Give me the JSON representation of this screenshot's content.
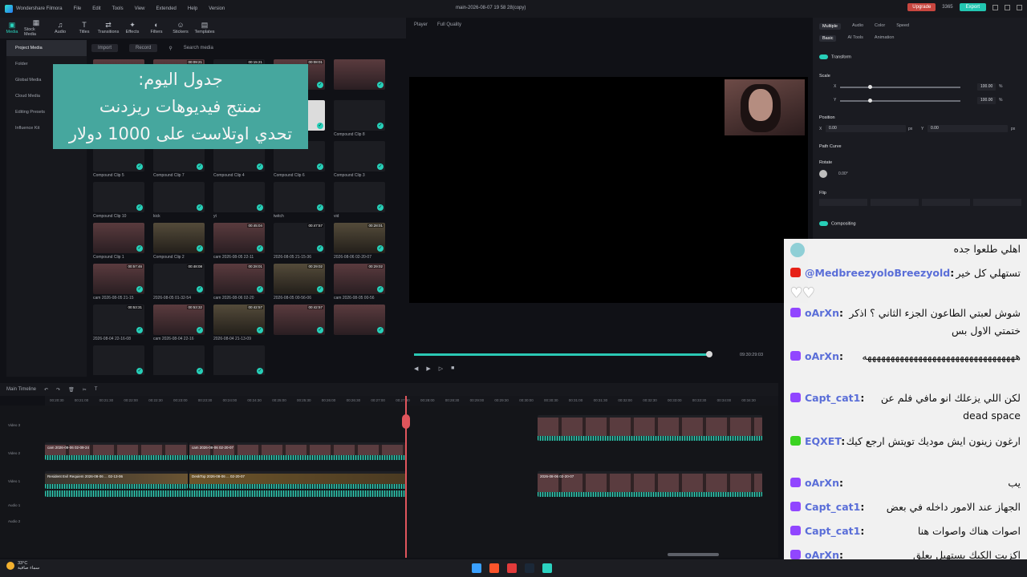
{
  "app": {
    "name": "Wondershare Filmora",
    "file": "main-2026-08-07 19 58 28(copy)",
    "credits": "3365",
    "upgrade": "Upgrade",
    "export": "Export"
  },
  "menu": [
    "File",
    "Edit",
    "Tools",
    "View",
    "Extended",
    "Help",
    "Version"
  ],
  "toolbar": [
    "Media",
    "Stock Media",
    "Audio",
    "Titles",
    "Transitions",
    "Effects",
    "Filters",
    "Stickers",
    "Templates"
  ],
  "sidebar": [
    "Project Media",
    "Folder",
    "Global Media",
    "Cloud Media",
    "Editing Presets",
    "Influence Kit"
  ],
  "mediabar": {
    "import": "Import",
    "record": "Record",
    "search_placeholder": "Search media"
  },
  "media": [
    {
      "name": "cam 2026-08-03 13-45",
      "dur": "",
      "t": "photo"
    },
    {
      "name": "",
      "dur": "00:09:21",
      "t": "photo"
    },
    {
      "name": "2026-08-05 00-59",
      "dur": "00:15:21",
      "t": "dark"
    },
    {
      "name": "",
      "dur": "00:08:01",
      "t": "photo"
    },
    {
      "name": "",
      "dur": "",
      "t": "photo"
    },
    {
      "name": "",
      "dur": "",
      "t": "photo"
    },
    {
      "name": "2026-08-05 23-51",
      "dur": "",
      "t": "dark"
    },
    {
      "name": "intro",
      "dur": "",
      "t": "dark"
    },
    {
      "name": "Compound Clip 9",
      "dur": "",
      "t": "white"
    },
    {
      "name": "Compound Clip 8",
      "dur": "",
      "t": "dark"
    },
    {
      "name": "Compound Clip 5",
      "dur": "",
      "t": "dark"
    },
    {
      "name": "Compound Clip 7",
      "dur": "",
      "t": "dark"
    },
    {
      "name": "Compound Clip 4",
      "dur": "",
      "t": "dark"
    },
    {
      "name": "Compound Clip 6",
      "dur": "",
      "t": "dark"
    },
    {
      "name": "Compound Clip 3",
      "dur": "",
      "t": "dark"
    },
    {
      "name": "Compound Clip 10",
      "dur": "",
      "t": "dark"
    },
    {
      "name": "kick",
      "dur": "",
      "t": "dark"
    },
    {
      "name": "yt",
      "dur": "",
      "t": "dark"
    },
    {
      "name": "twitch",
      "dur": "",
      "t": "dark"
    },
    {
      "name": "vid",
      "dur": "",
      "t": "dark"
    },
    {
      "name": "Compound Clip 1",
      "dur": "",
      "t": "photo"
    },
    {
      "name": "Compound Clip 2",
      "dur": "",
      "t": "scene"
    },
    {
      "name": "cam 2026-08-05 22-11",
      "dur": "00:45:04",
      "t": "photo"
    },
    {
      "name": "2026-08-05 21-15-36",
      "dur": "00:47:57",
      "t": "dark"
    },
    {
      "name": "2026-08-06 02-20-07",
      "dur": "00:28:01",
      "t": "scene"
    },
    {
      "name": "cam 2026-08-05 21-15",
      "dur": "00:57:46",
      "t": "photo"
    },
    {
      "name": "2026-08-05 01-32-54",
      "dur": "00:48:08",
      "t": "dark"
    },
    {
      "name": "cam 2026-08-06 02-20",
      "dur": "00:28:01",
      "t": "photo"
    },
    {
      "name": "2026-08-05 00-56-06",
      "dur": "00:29:02",
      "t": "scene"
    },
    {
      "name": "cam 2026-08-05 00-56",
      "dur": "00:29:02",
      "t": "photo"
    },
    {
      "name": "2026-08-04 22-16-08",
      "dur": "00:53:31",
      "t": "dark"
    },
    {
      "name": "cam 2026-08-04 22-16",
      "dur": "00:53:32",
      "t": "photo"
    },
    {
      "name": "2026-08-04 21-13-09",
      "dur": "00:42:57",
      "t": "scene"
    },
    {
      "name": "",
      "dur": "00:42:57",
      "t": "photo"
    },
    {
      "name": "",
      "dur": "",
      "t": "photo"
    },
    {
      "name": "",
      "dur": "",
      "t": "dark"
    },
    {
      "name": "",
      "dur": "",
      "t": "dark"
    },
    {
      "name": "",
      "dur": "",
      "t": "dark"
    }
  ],
  "overlay": [
    "جدول اليوم:",
    "نمنتج فيديوهات ريزدنت",
    "تحدي اوتلاست على 1000 دولار"
  ],
  "player": {
    "label": "Player",
    "quality": "Full Quality",
    "time": "09:30:29:03",
    "total": "/ 10"
  },
  "props": {
    "tabs": [
      "Multiple",
      "Audio",
      "Color",
      "Speed"
    ],
    "subtabs": [
      "Basic",
      "AI Tools",
      "Animation"
    ],
    "transform": "Transform",
    "scale": "Scale",
    "x": "X",
    "y": "Y",
    "scale_x": "100.00",
    "scale_y": "100.00",
    "pct": "%",
    "position": "Position",
    "pos_x": "0.00",
    "pos_y": "0.00",
    "px": "px",
    "path_curve": "Path Curve",
    "rotate": "Rotate",
    "rotate_val": "0.00°",
    "flip": "Flip",
    "compositing": "Compositing"
  },
  "timeline": {
    "name": "Main Timeline",
    "ticks": [
      "00:20:30",
      "00:21:00",
      "00:21:30",
      "00:22:00",
      "00:22:30",
      "00:23:00",
      "00:23:30",
      "00:24:00",
      "00:24:30",
      "00:25:00",
      "00:25:30",
      "00:26:00",
      "00:26:30",
      "00:27:00",
      "00:27:30",
      "00:28:00",
      "00:28:30",
      "00:29:00",
      "00:29:30",
      "00:30:00",
      "00:30:30",
      "00:31:00",
      "00:31:30",
      "00:32:00",
      "00:32:30",
      "00:33:00",
      "00:33:30",
      "00:34:00",
      "00:34:30"
    ],
    "tracks": [
      "Video 3",
      "Video 2",
      "Video 1",
      "Audio 1",
      "Audio 2"
    ],
    "clips": {
      "c1": "cam 2026-08-06 02-09-24",
      "c2": "cam 2026-08-06 02-20-07",
      "c3": "Resident Evil Requiem 2026-08-06 ... 02-13-06",
      "c4": "DeskTop 2026-08-06 ... 02-20-07",
      "c5": "2026-08-06 02-20-07"
    }
  },
  "chat": [
    {
      "user": "",
      "text": "اهلي طلعوا جده",
      "platform": "avatar"
    },
    {
      "user": "@MedbreezyoloBreezyold",
      "text": "تستهلي كل خير",
      "platform": "yt"
    },
    {
      "user": "oArXn",
      "text": "شوش لعبتي الطاعون الجزء الثاني ؟ اذكر ختمتي الاول بس",
      "platform": "tw"
    },
    {
      "user": "oArXn",
      "text": "هههههههههههههههههههههههههههههههههه",
      "platform": "tw"
    },
    {
      "user": "Capt_cat1",
      "text": "لكن اللي يزعلك انو مافي فلم عن dead space",
      "platform": "tw"
    },
    {
      "user": "EQXET",
      "text": "ارغون زينون ايش موديك تويتش ارجع كيك",
      "platform": "kk"
    },
    {
      "user": "oArXn",
      "text": "يب",
      "platform": "tw"
    },
    {
      "user": "Capt_cat1",
      "text": "الجهاز عند الامور داخله في بعض",
      "platform": "tw"
    },
    {
      "user": "Capt_cat1",
      "text": "اصوات هناك واصوات هنا",
      "platform": "tw"
    },
    {
      "user": "oArXn",
      "text": "اكزيت الكيك يستهبل يعلق",
      "platform": "tw"
    }
  ],
  "taskbar": {
    "temp": "33°C",
    "weather": "سماء صافية"
  }
}
